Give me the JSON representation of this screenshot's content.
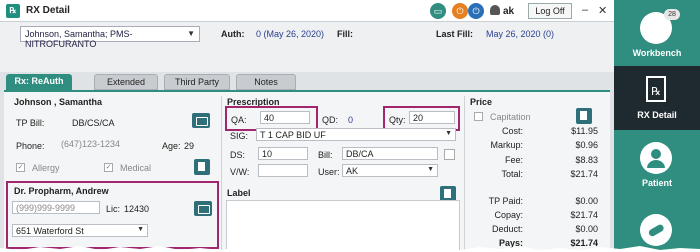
{
  "window": {
    "title": "RX Detail",
    "user": "ak",
    "logoff_label": "Log Off",
    "minimize": "–",
    "close": "✕"
  },
  "header": {
    "patient_select": "Johnson, Samantha; PMS-NITROFURANTO",
    "auth_label": "Auth:",
    "auth_value": "0 (May 26, 2020)",
    "fill_label": "Fill:",
    "last_fill_label": "Last Fill:",
    "last_fill_value": "May 26, 2020 (0)"
  },
  "tabs": [
    {
      "label": "Rx: ReAuth",
      "active": true
    },
    {
      "label": "Extended",
      "active": false
    },
    {
      "label": "Third Party",
      "active": false
    },
    {
      "label": "Notes",
      "active": false
    }
  ],
  "patient": {
    "name": "Johnson , Samantha",
    "tp_bill_label": "TP Bill:",
    "tp_bill_value": "DB/CS/CA",
    "phone_label": "Phone:",
    "phone_value": "(647)123-1234",
    "age_label": "Age:",
    "age_value": "29",
    "allergy_label": "Allergy",
    "medical_label": "Medical"
  },
  "doctor": {
    "name": "Dr. Propharm, Andrew",
    "phone_value": "(999)999-9999",
    "lic_label": "Lic:",
    "lic_value": "12430",
    "address": "651 Waterford St"
  },
  "prescription": {
    "title": "Prescription",
    "qa_label": "QA:",
    "qa_value": "40",
    "qd_label": "QD:",
    "qd_value": "0",
    "qty_label": "Qty:",
    "qty_value": "20",
    "sig_label": "SIG:",
    "sig_value": "T 1 CAP BID UF",
    "ds_label": "DS:",
    "ds_value": "10",
    "bill_label": "Bill:",
    "bill_value": "DB/CA",
    "vw_label": "V/W:",
    "user_label": "User:",
    "user_value": "AK",
    "label_title": "Label"
  },
  "price": {
    "title": "Price",
    "capitation_label": "Capitation",
    "rows": [
      {
        "label": "Cost:",
        "value": "$11.95"
      },
      {
        "label": "Markup:",
        "value": "$0.96"
      },
      {
        "label": "Fee:",
        "value": "$8.83"
      },
      {
        "label": "Total:",
        "value": "$21.74"
      }
    ],
    "rows2": [
      {
        "label": "TP Paid:",
        "value": "$0.00"
      },
      {
        "label": "Copay:",
        "value": "$21.74"
      },
      {
        "label": "Deduct:",
        "value": "$0.00"
      },
      {
        "label": "Pays:",
        "value": "$21.74"
      }
    ]
  },
  "sidebar": {
    "items": [
      {
        "label": "Workbench",
        "badge": "28"
      },
      {
        "label": "RX Detail"
      },
      {
        "label": "Patient"
      },
      {
        "label": ""
      }
    ]
  },
  "colors": {
    "accent": "#2f8e80",
    "highlight": "#a2266e",
    "sidebar_active": "#1f2a30"
  }
}
